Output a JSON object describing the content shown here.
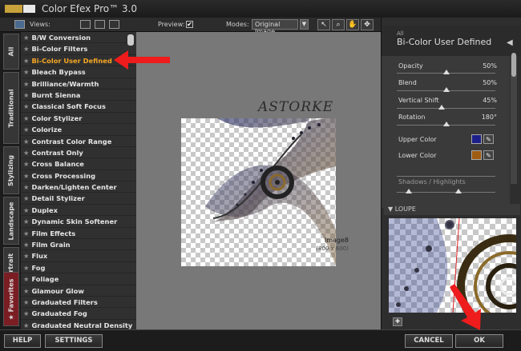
{
  "app": {
    "title": "Color Efex Pro™ 3.0"
  },
  "toolbar": {
    "views_label": "Views:",
    "preview_label": "Preview:",
    "preview_checked": "✔",
    "modes_label": "Modes:",
    "mode_value": "Original Image",
    "tools": [
      "pointer-icon",
      "zoom-icon",
      "hand-icon",
      "pan-icon"
    ]
  },
  "tabs": [
    "All",
    "Traditional",
    "Stylizing",
    "Landscape",
    "Portrait",
    "Favorites"
  ],
  "filters": [
    "B/W Conversion",
    "Bi-Color Filters",
    "Bi-Color User Defined",
    "Bleach Bypass",
    "Brilliance/Warmth",
    "Burnt Sienna",
    "Classical Soft Focus",
    "Color Stylizer",
    "Colorize",
    "Contrast Color Range",
    "Contrast Only",
    "Cross Balance",
    "Cross Processing",
    "Darken/Lighten Center",
    "Detail Stylizer",
    "Duplex",
    "Dynamic Skin Softener",
    "Film Effects",
    "Film Grain",
    "Flux",
    "Fog",
    "Foliage",
    "Glamour Glow",
    "Graduated Filters",
    "Graduated Fog",
    "Graduated Neutral Density"
  ],
  "selected_filter": "Bi-Color User Defined",
  "preview": {
    "image_name": "Image8",
    "image_size": "(800 x 600)",
    "watermark": "ASTORKE"
  },
  "panel": {
    "category": "All",
    "filter_name": "Bi-Color User Defined",
    "collapse_glyph": "◀",
    "params": [
      {
        "label": "Opacity",
        "value": "50%",
        "level": 0.5
      },
      {
        "label": "Blend",
        "value": "50%",
        "level": 0.5
      },
      {
        "label": "Vertical Shift",
        "value": "45%",
        "level": 0.45
      },
      {
        "label": "Rotation",
        "value": "180°",
        "level": 0.5
      }
    ],
    "upper_color_label": "Upper Color",
    "upper_color": "#1c1f8a",
    "lower_color_label": "Lower Color",
    "lower_color": "#a05c10",
    "shadows_label": "Shadows / Highlights",
    "loupe_label": "▼ LOUPE"
  },
  "bottom": {
    "help": "HELP",
    "settings": "SETTINGS",
    "cancel": "CANCEL",
    "ok": "OK"
  },
  "colors": {
    "accent": "#f5a623",
    "arrow": "#ee1c1c"
  }
}
